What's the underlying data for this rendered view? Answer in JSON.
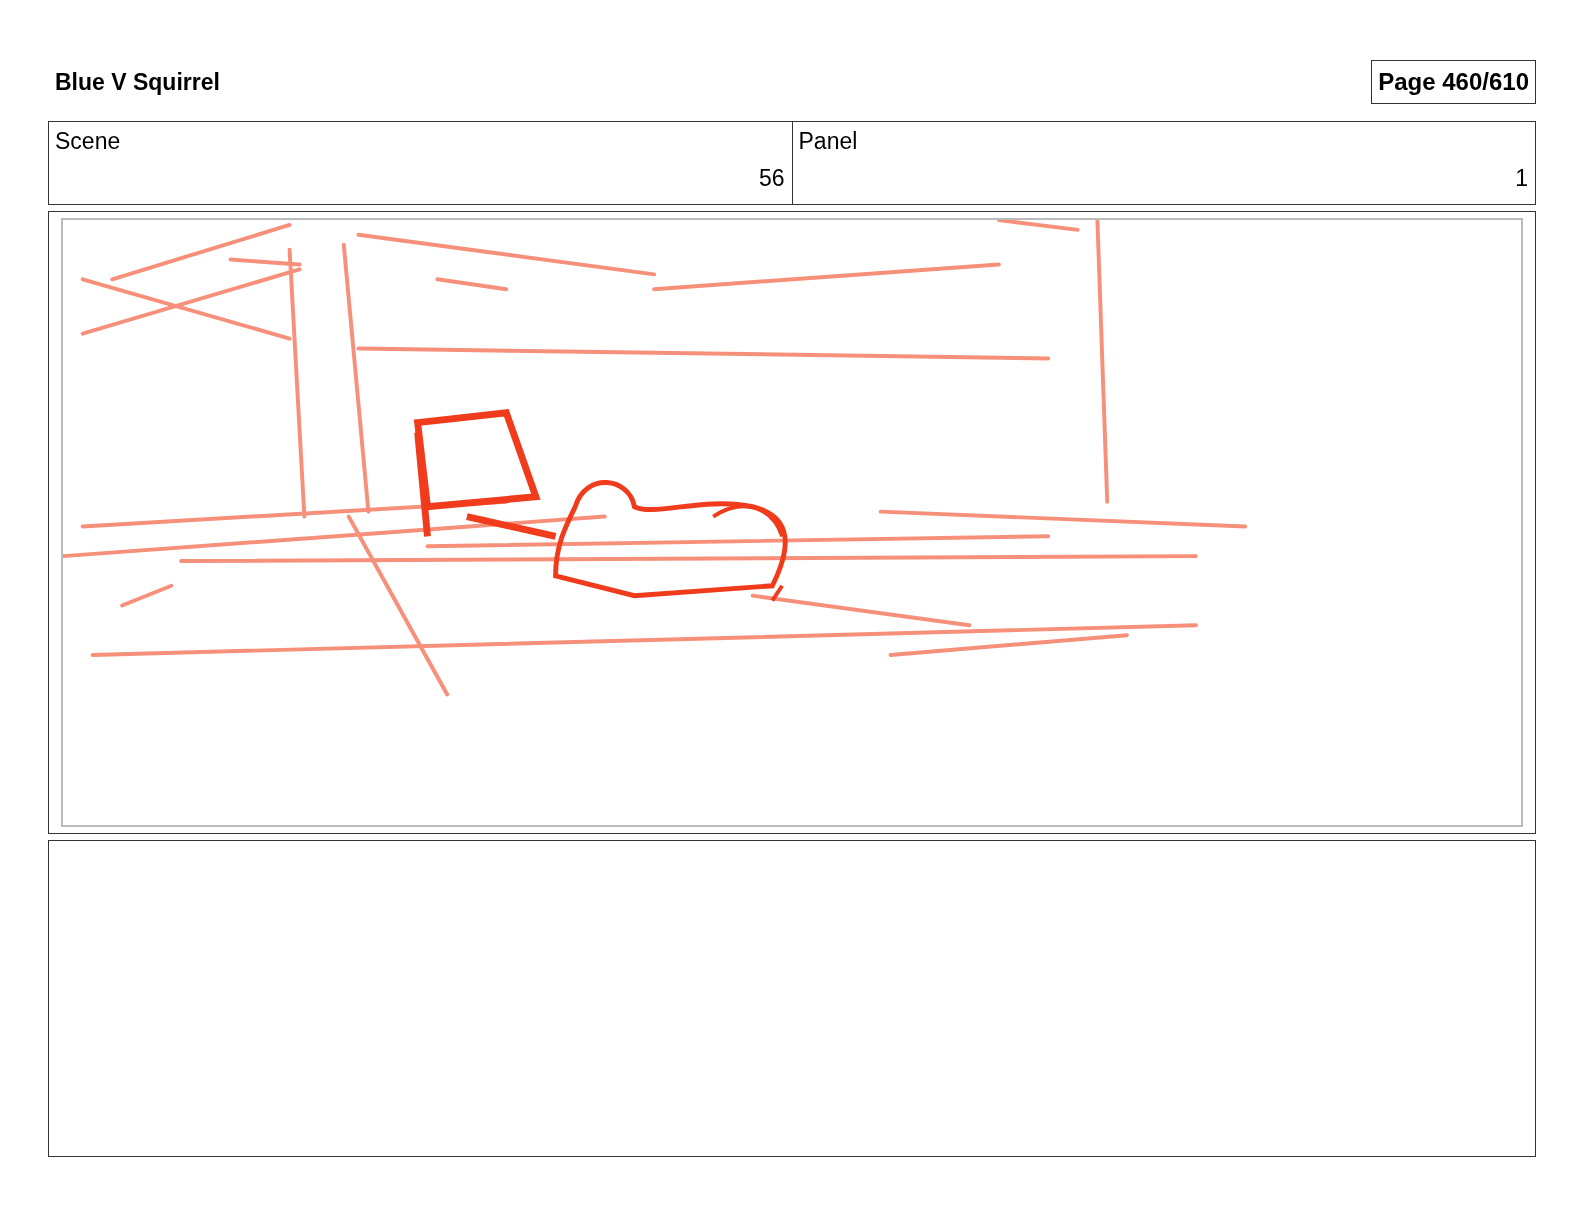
{
  "header": {
    "title": "Blue V Squirrel",
    "page": "Page 460/610"
  },
  "fields": [
    {
      "heading": "Scene",
      "number": "56"
    },
    {
      "heading": "Panel",
      "number": "1"
    }
  ]
}
